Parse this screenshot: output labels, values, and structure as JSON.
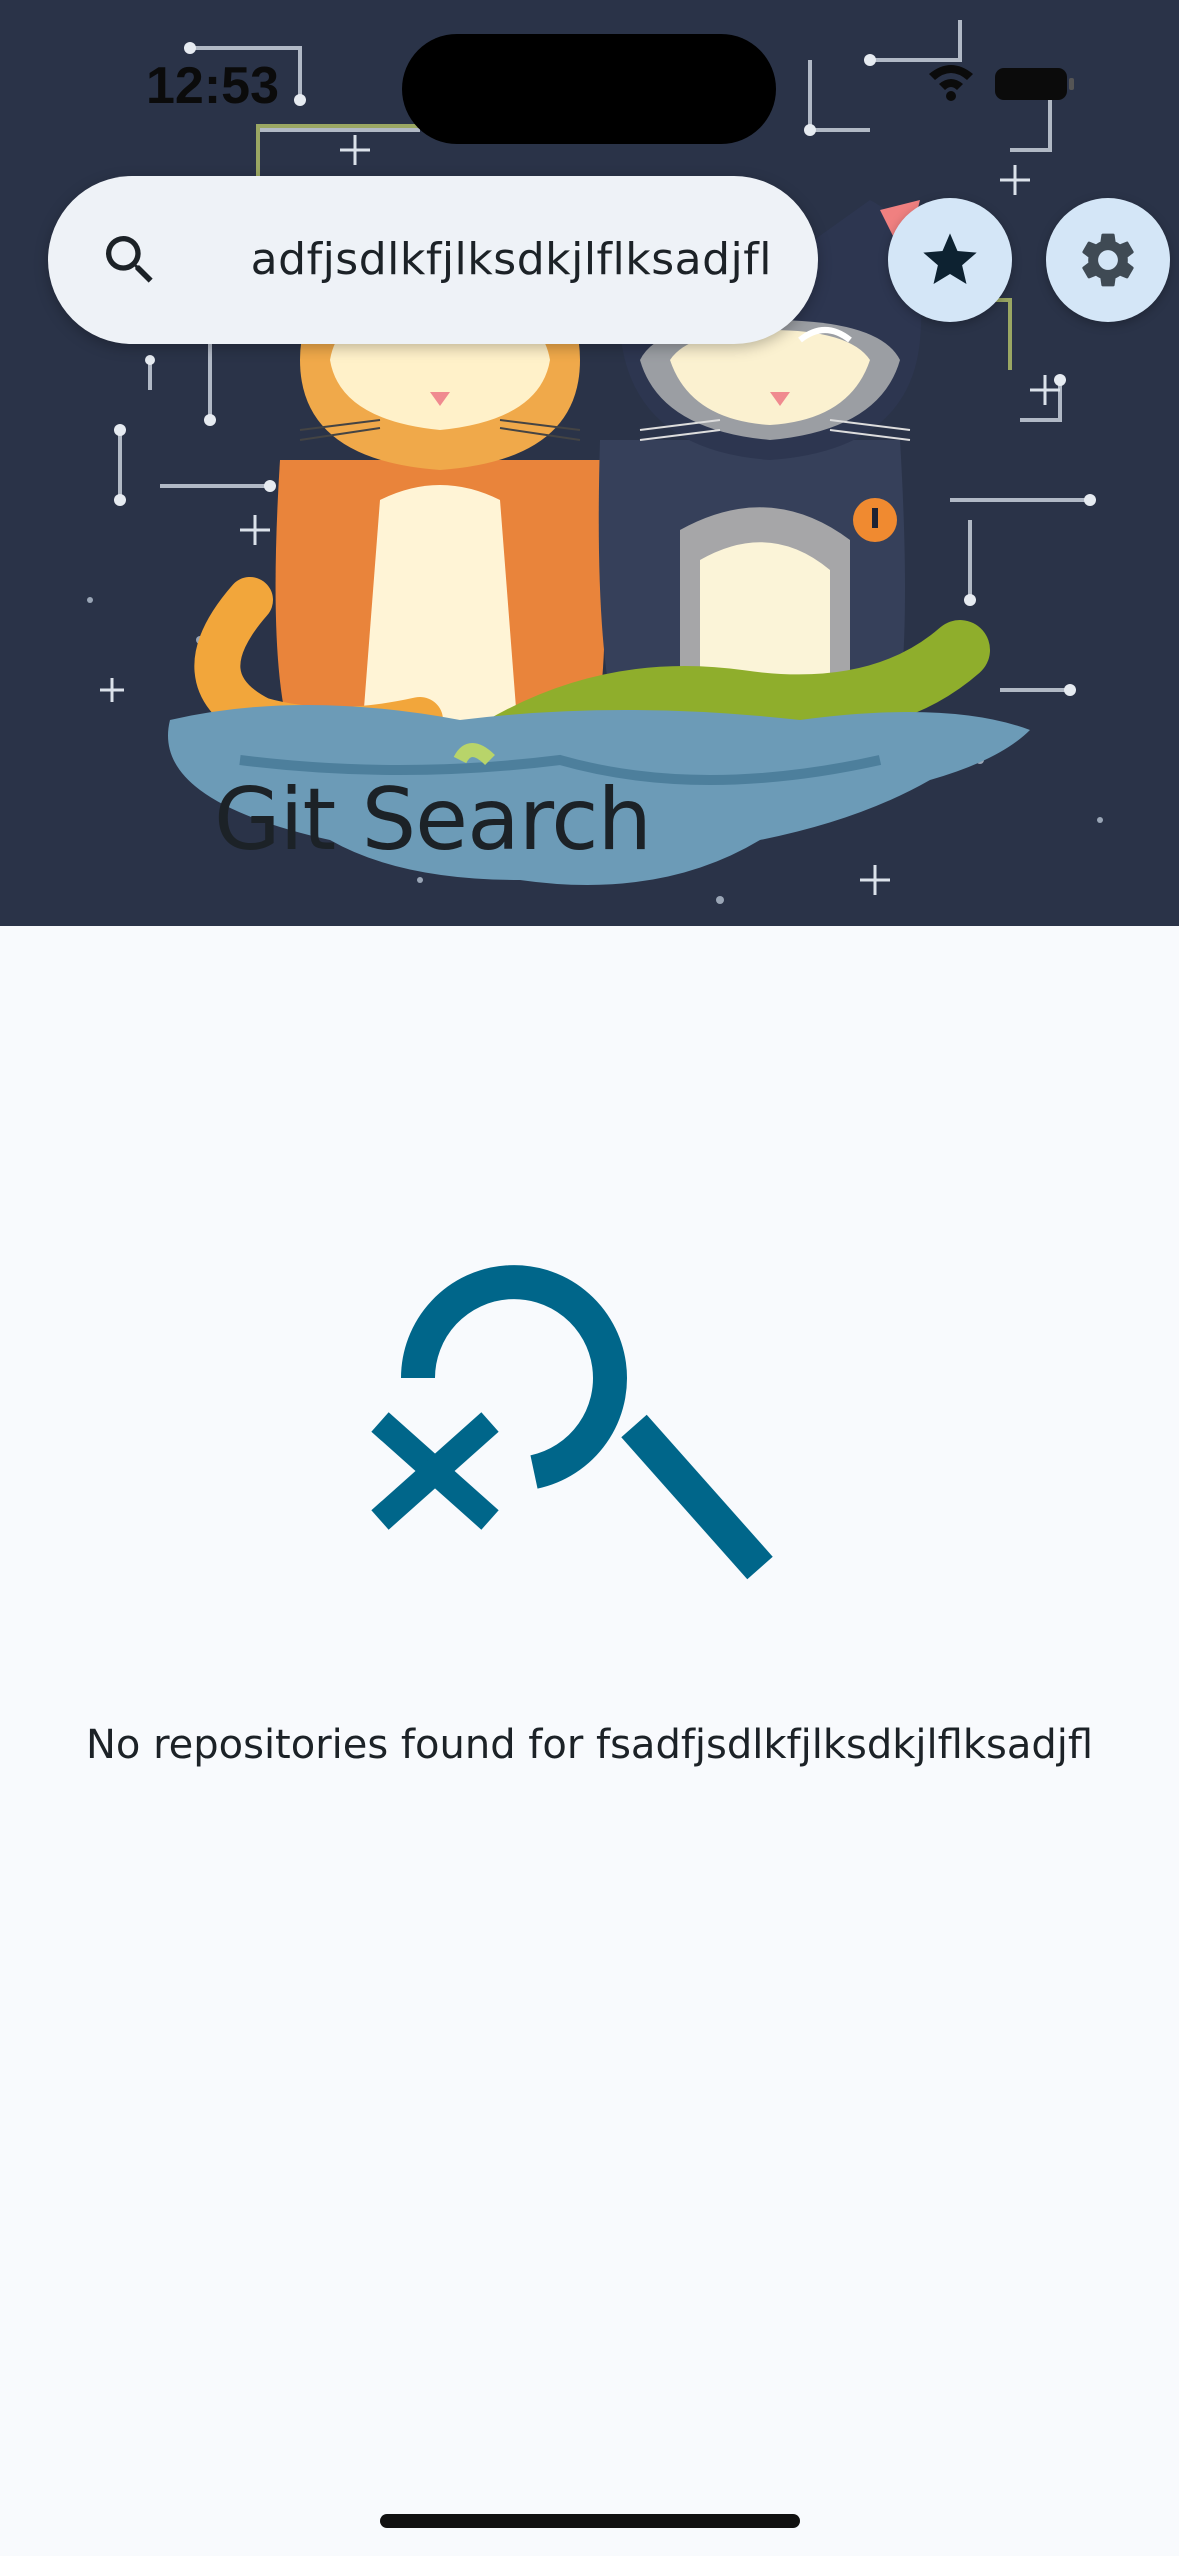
{
  "status_bar": {
    "time": "12:53"
  },
  "search": {
    "query": "fsadfjsdlkfjlksdkjlflksadjfl",
    "icon": "search-icon"
  },
  "header": {
    "title": "Git Search",
    "actions": [
      {
        "icon": "star-icon"
      },
      {
        "icon": "gear-icon"
      }
    ]
  },
  "empty_state": {
    "icon": "search-off-icon",
    "message": "No repositories found for fsadfjsdlkfjlksdkjlflksadjfl"
  },
  "colors": {
    "accent": "#00668a",
    "hero_background": "#2a3348",
    "button_background": "#d4e6f7",
    "page_background": "#f8fafd"
  }
}
